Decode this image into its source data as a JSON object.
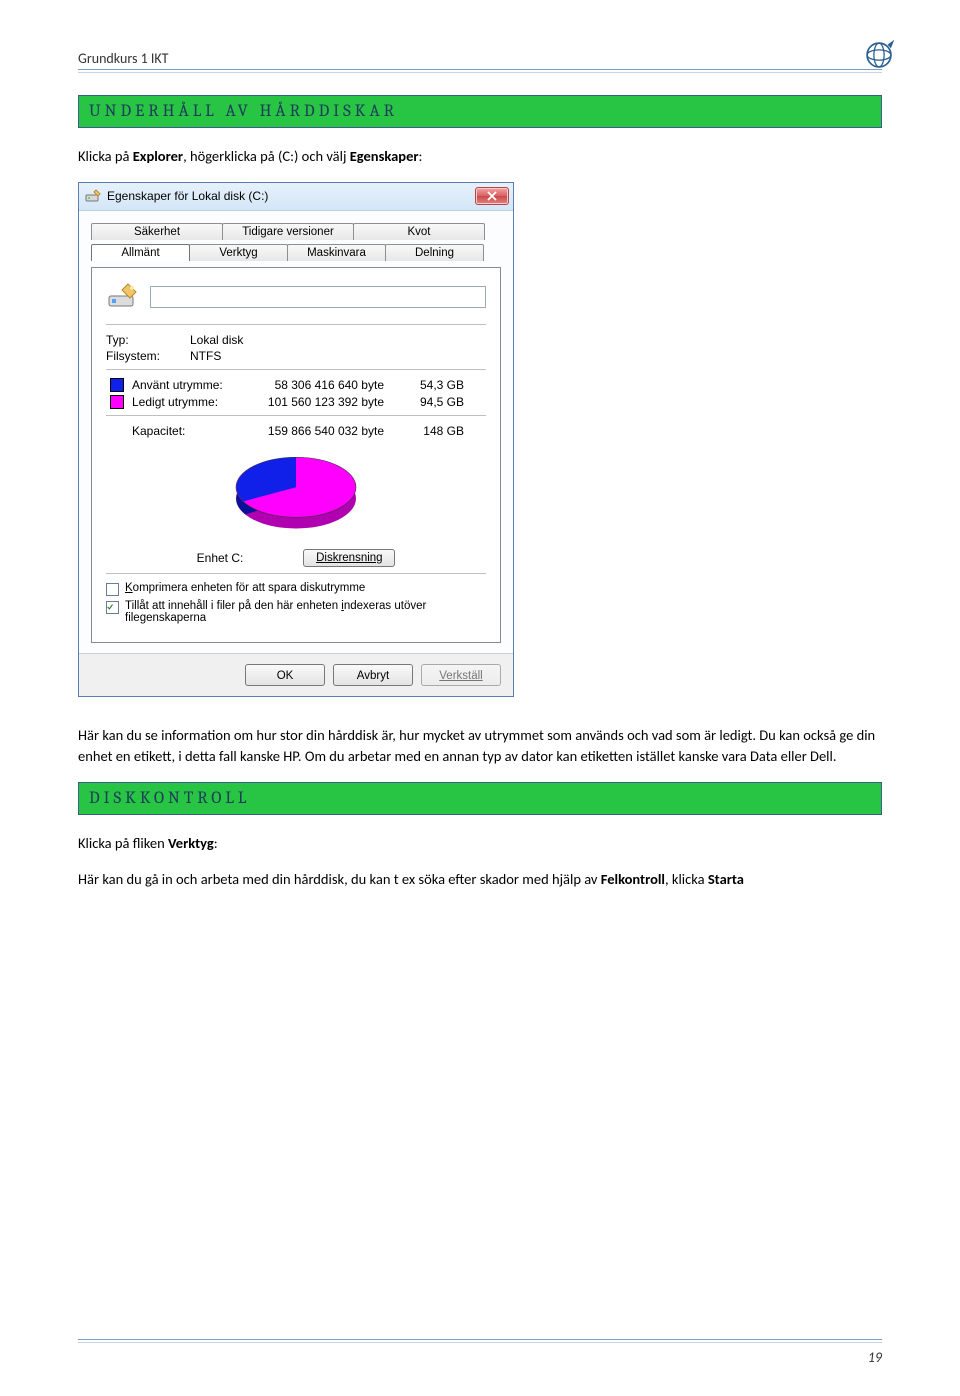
{
  "doc": {
    "course_title": "Grundkurs 1 IKT",
    "page_number": "19"
  },
  "section1": {
    "title": "UNDERHÅLL AV HÅRDDISKAR",
    "intro_pre": "Klicka på ",
    "intro_b1": "Explorer",
    "intro_mid": ", högerklicka på (C:) och välj ",
    "intro_b2": "Egenskaper",
    "intro_post": ":",
    "para1": "Här kan du se information om hur stor din hårddisk är, hur mycket av utrymmet som används och vad som är ledigt. Du kan också ge din enhet en etikett, i detta fall kanske HP. Om du arbetar med en annan typ av dator kan etiketten istället kanske vara Data eller Dell."
  },
  "section2": {
    "title": "DISKKONTROLL",
    "line1_pre": "Klicka på fliken ",
    "line1_b": "Verktyg",
    "line1_post": ":",
    "line2_pre": "Här kan du gå in och arbeta med din hårddisk, du kan t ex söka efter skador med hjälp av ",
    "line2_b": "Felkontroll",
    "line2_mid": ", klicka ",
    "line2_b2": "Starta"
  },
  "dialog": {
    "title": "Egenskaper för Lokal disk (C:)",
    "tabs_row1": [
      "Säkerhet",
      "Tidigare versioner",
      "Kvot"
    ],
    "tabs_row2": [
      "Allmänt",
      "Verktyg",
      "Maskinvara",
      "Delning"
    ],
    "name_input": "",
    "typ_label": "Typ:",
    "typ_value": "Lokal disk",
    "fs_label": "Filsystem:",
    "fs_value": "NTFS",
    "used_label": "Använt utrymme:",
    "used_bytes": "58 306 416 640 byte",
    "used_gb": "54,3 GB",
    "free_label": "Ledigt utrymme:",
    "free_bytes": "101 560 123 392 byte",
    "free_gb": "94,5 GB",
    "cap_label": "Kapacitet:",
    "cap_bytes": "159 866 540 032 byte",
    "cap_gb": "148 GB",
    "enhet_label": "Enhet C:",
    "diskrensning": "Diskrensning",
    "chk1": "Komprimera enheten för att spara diskutrymme",
    "chk2": "Tillåt att innehåll i filer på den här enheten indexeras utöver filegenskaperna",
    "ok": "OK",
    "avbryt": "Avbryt",
    "verkstall": "Verkställ"
  },
  "chart_data": {
    "type": "pie",
    "title": "Enhet C:",
    "series": [
      {
        "name": "Använt utrymme",
        "value": 54.3,
        "unit": "GB",
        "color": "#1020e8"
      },
      {
        "name": "Ledigt utrymme",
        "value": 94.5,
        "unit": "GB",
        "color": "#ff00ff"
      }
    ],
    "total": {
      "name": "Kapacitet",
      "value": 148,
      "unit": "GB"
    }
  }
}
